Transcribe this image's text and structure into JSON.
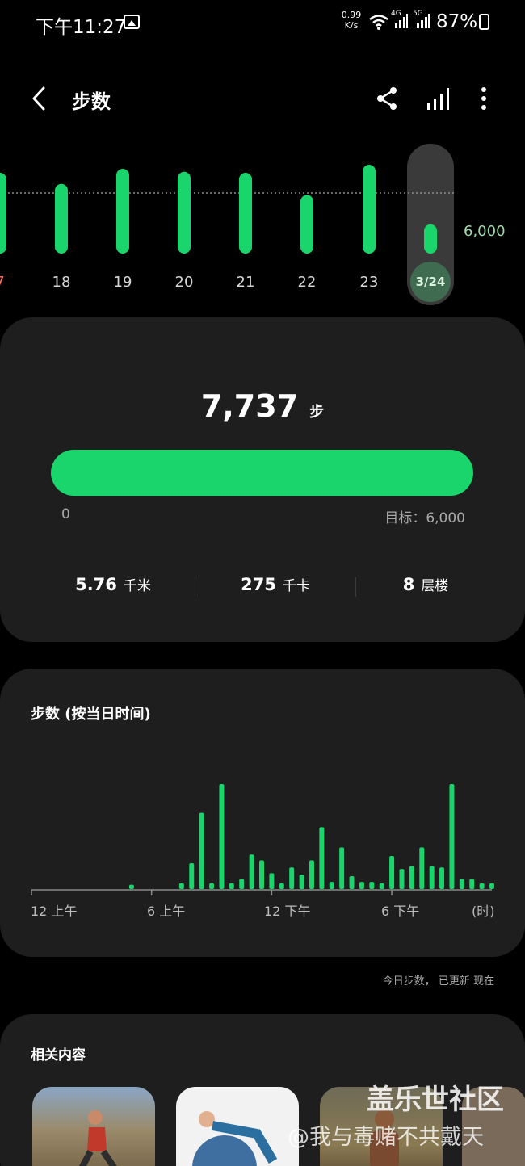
{
  "status_bar": {
    "time": "下午11:27",
    "speed_value": "0.99",
    "speed_unit": "K/s",
    "net1": "4G",
    "net2": "5G",
    "battery": "87%"
  },
  "header": {
    "title": "步数",
    "icons": [
      "back-icon",
      "share-icon",
      "chart-icon",
      "more-icon"
    ]
  },
  "weekly_chart": {
    "goal_label": "6,000",
    "days": [
      {
        "label": "7",
        "red": true,
        "value": 8000
      },
      {
        "label": "18",
        "red": false,
        "value": 6900
      },
      {
        "label": "19",
        "red": false,
        "value": 8400
      },
      {
        "label": "20",
        "red": false,
        "value": 8100
      },
      {
        "label": "21",
        "red": false,
        "value": 8000
      },
      {
        "label": "22",
        "red": false,
        "value": 5800
      },
      {
        "label": "23",
        "red": false,
        "value": 8800
      }
    ],
    "selected": {
      "label": "3/24",
      "value": 2900
    }
  },
  "summary": {
    "steps": "7,737",
    "steps_unit": "步",
    "progress_fraction": 1.0,
    "min_label": "0",
    "goal_label": "目标：6,000",
    "stats": [
      {
        "value": "5.76",
        "unit": "千米"
      },
      {
        "value": "275",
        "unit": "千卡"
      },
      {
        "value": "8",
        "unit": "层楼"
      }
    ]
  },
  "chart_data": {
    "type": "bar",
    "title": "步数 (按当日时间)",
    "x_tick_labels": [
      "12 上午",
      "6 上午",
      "12 下午",
      "6 下午",
      "(时)"
    ],
    "accent_color": "#1ad46c",
    "values": [
      0,
      0,
      0,
      0,
      0,
      0,
      0,
      0,
      0,
      0,
      3,
      0,
      0,
      0,
      0,
      4,
      18,
      53,
      4,
      73,
      4,
      7,
      24,
      20,
      11,
      4,
      15,
      10,
      20,
      43,
      5,
      29,
      9,
      5,
      5,
      4,
      23,
      14,
      16,
      29,
      16,
      15,
      73,
      7,
      7,
      4,
      4
    ]
  },
  "footer": {
    "updated": "今日步数， 已更新 现在"
  },
  "related": {
    "title": "相关内容"
  },
  "watermark": {
    "line1": "盖乐世社区",
    "line2": "@我与毒赌不共戴天"
  }
}
